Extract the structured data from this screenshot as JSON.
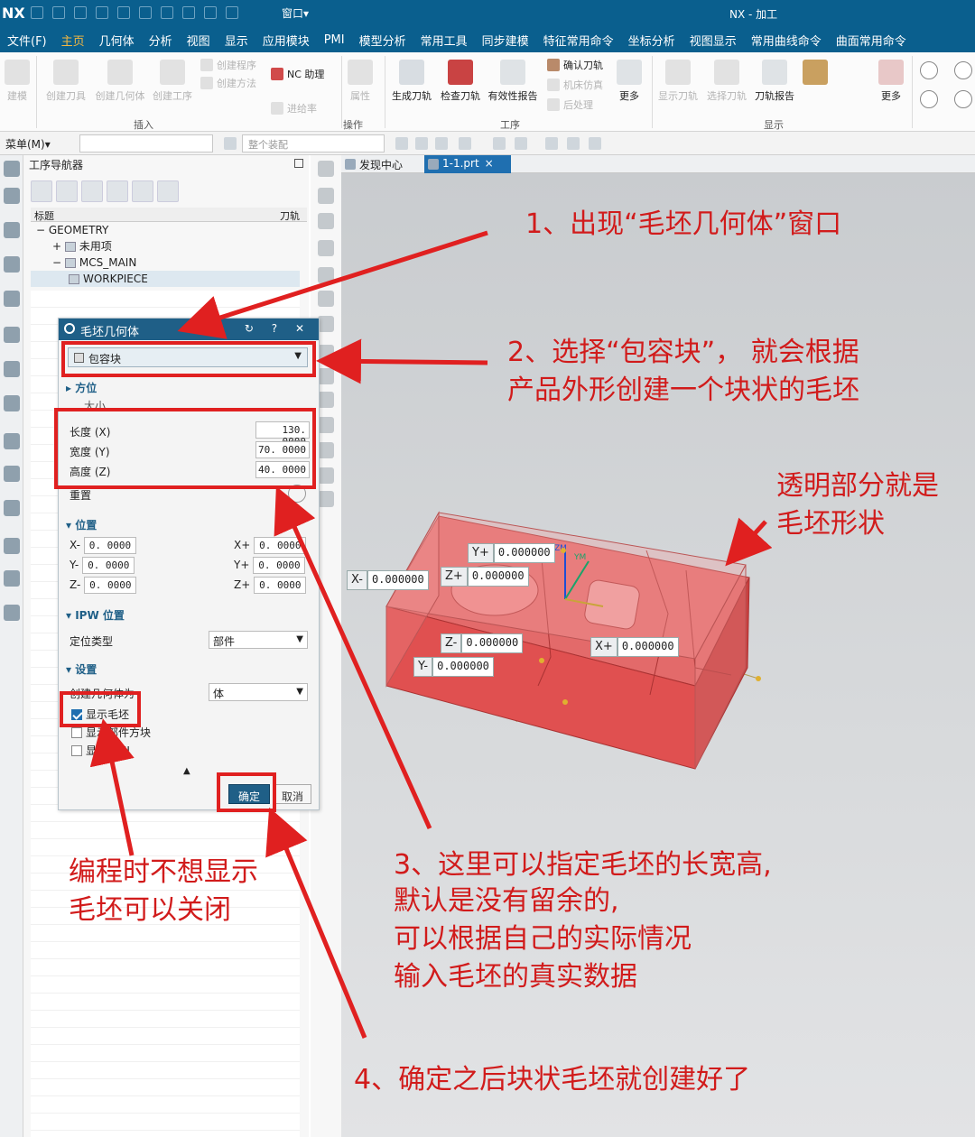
{
  "app": {
    "logo": "NX",
    "window_menu": "窗口▾",
    "window_title": "NX - 加工"
  },
  "menu_tabs": [
    "文件(F)",
    "主页",
    "几何体",
    "分析",
    "视图",
    "显示",
    "应用模块",
    "PMI",
    "模型分析",
    "常用工具",
    "同步建模",
    "特征常用命令",
    "坐标分析",
    "视图显示",
    "常用曲线命令",
    "曲面常用命令"
  ],
  "active_tab": "主页",
  "ribbon": {
    "left_button": "建模",
    "insert_buttons": [
      "创建刀具",
      "创建几何体",
      "创建工序"
    ],
    "insert_small": [
      "创建程序",
      "创建方法"
    ],
    "nc_assistant": "NC 助理",
    "feed_rate": "进给率",
    "attr_button": "属性",
    "operation_buttons": [
      "生成刀轨",
      "检查刀轨",
      "有效性报告"
    ],
    "operation_small": [
      "确认刀轨",
      "机床仿真",
      "后处理"
    ],
    "more": "更多",
    "display_buttons": [
      "显示刀轨",
      "选择刀轨",
      "刀轨报告"
    ],
    "more2": "更多",
    "group_labels": [
      "插入",
      "操作",
      "工序",
      "显示"
    ]
  },
  "cmdbar": {
    "menu": "菜单(M)▾",
    "assembly_scope": "整个装配"
  },
  "navigator": {
    "title": "工序导航器",
    "col_title": "标题",
    "col_tool": "刀轨",
    "tree": [
      {
        "label": "GEOMETRY",
        "indent": 0,
        "prefix": "−"
      },
      {
        "label": "未用项",
        "indent": 1,
        "prefix": "+"
      },
      {
        "label": "MCS_MAIN",
        "indent": 1,
        "prefix": "−"
      },
      {
        "label": "WORKPIECE",
        "indent": 2,
        "prefix": ""
      }
    ]
  },
  "dialog": {
    "title": "毛坯几何体",
    "title_buttons": "↻ ? ✕",
    "type": "包容块",
    "section_orient": "方位",
    "section_size": "大小",
    "length_label": "长度 (X)",
    "length_value": "130. 0000",
    "width_label": "宽度 (Y)",
    "width_value": "70. 0000",
    "height_label": "高度 (Z)",
    "height_value": "40. 0000",
    "reset_label": "重置",
    "section_position": "位置",
    "pos": {
      "x_minus": "X-",
      "x_minus_val": "0. 0000",
      "y_minus": "Y-",
      "y_minus_val": "0. 0000",
      "z_minus": "Z-",
      "z_minus_val": "0. 0000",
      "x_plus": "X+",
      "x_plus_val": "0. 0000",
      "y_plus": "Y+",
      "y_plus_val": "0. 0000",
      "z_plus": "Z+",
      "z_plus_val": "0. 0000"
    },
    "section_ipw": "IPW 位置",
    "locate_type_label": "定位类型",
    "locate_type_value": "部件",
    "section_settings": "设置",
    "create_as_label": "创建几何体为",
    "create_as_value": "体",
    "show_blank": "显示毛坯",
    "show_part_block": "显示部件方块",
    "show_pmi": "显示 PMI",
    "ok": "确定",
    "cancel": "取消"
  },
  "viewport": {
    "tab_discovery": "发现中心",
    "tab_part": "1-1.prt",
    "coords": {
      "x_minus": "X-",
      "x_minus_val": "0.000000",
      "y_plus": "Y+",
      "y_plus_val": "0.000000",
      "z_plus": "Z+",
      "z_plus_val": "0.000000",
      "z_minus": "Z-",
      "z_minus_val": "0.000000",
      "y_minus": "Y-",
      "y_minus_val": "0.000000",
      "x_plus": "X+",
      "x_plus_val": "0.000000"
    },
    "axis_zm": "ZM",
    "axis_ym": "YM"
  },
  "annotations": {
    "a1": "1、出现“毛坯几何体”窗口",
    "a2_line1": "2、选择“包容块”， 就会根据",
    "a2_line2": "产品外形创建一个块状的毛坯",
    "a_trans_line1": "透明部分就是",
    "a_trans_line2": "毛坯形状",
    "a3_line1": "3、这里可以指定毛坯的长宽高,",
    "a3_line2": "默认是没有留余的,",
    "a3_line3": "可以根据自己的实际情况",
    "a3_line4": "输入毛坯的真实数据",
    "a_off_line1": "编程时不想显示",
    "a_off_line2": "毛坯可以关闭",
    "a4": "4、确定之后块状毛坯就创建好了"
  },
  "colors": {
    "title_bar": "#0a5f8e",
    "annotation_red": "#d11b1b",
    "part_red": "#e66262"
  }
}
